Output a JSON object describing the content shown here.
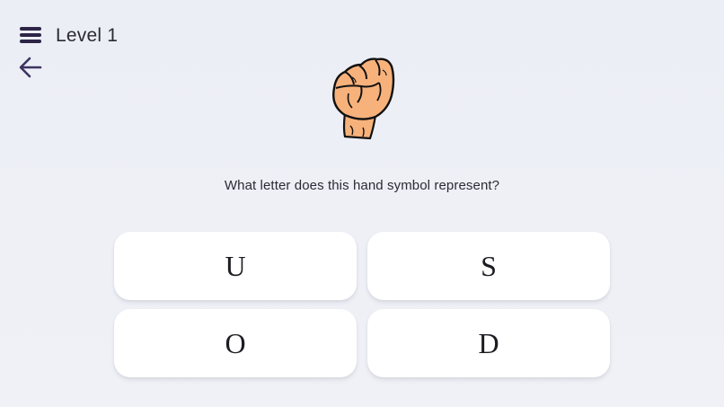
{
  "header": {
    "level_title": "Level 1",
    "menu_icon": "hamburger-menu-icon",
    "back_icon": "arrow-left-icon"
  },
  "prompt": {
    "image": "asl-fist-hand-sign",
    "question": "What letter does this hand symbol represent?"
  },
  "options": [
    {
      "label": "U"
    },
    {
      "label": "S"
    },
    {
      "label": "O"
    },
    {
      "label": "D"
    }
  ],
  "colors": {
    "background": "#eceef5",
    "icon": "#2d2547",
    "card": "#ffffff",
    "skin": "#f7b27c"
  }
}
